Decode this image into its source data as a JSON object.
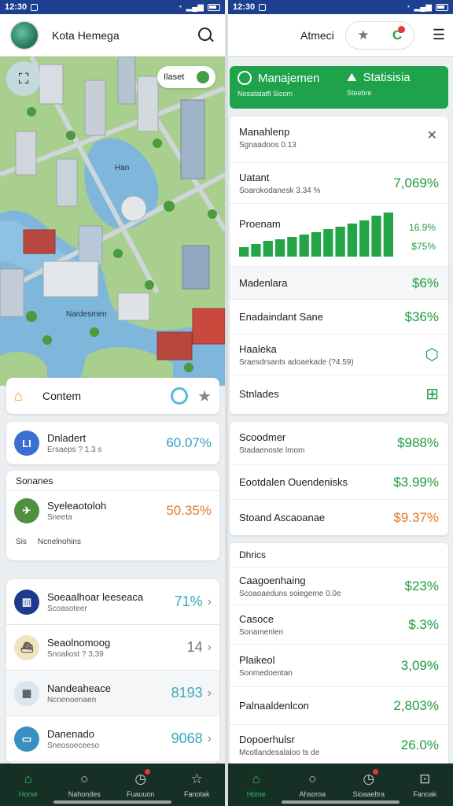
{
  "status_left": {
    "time": "12:30"
  },
  "status_right": {
    "time": "12:30"
  },
  "header_left": {
    "title": "Kota Hemega"
  },
  "header_right": {
    "user_name": "Atmeci"
  },
  "map": {
    "toggle_label": "Ilaset",
    "labels": [
      "Han",
      "Nardesmen"
    ]
  },
  "content_bar": {
    "label": "Contem"
  },
  "stat_card": {
    "icon_text": "LI",
    "title": "Dnladert",
    "subtitle": "Ersaeps ? 1.3 s",
    "value": "60.07%"
  },
  "sources": {
    "header": "Sonanes",
    "row": {
      "title": "Syeleaotoloh",
      "subtitle": "Sneeta",
      "value": "50.35%"
    },
    "footer": {
      "tag": "Sis",
      "text": "Ncnelnohins"
    }
  },
  "list": [
    {
      "title": "Soeaalhoar leeseaca",
      "subtitle": "Scoasoteer",
      "value": "71%",
      "color": "#1f3a8a"
    },
    {
      "title": "Seaolnomoog",
      "subtitle": "Snoaliost ? 3,39",
      "value": "14",
      "color": "#f0e3c0"
    },
    {
      "title": "Nandeaheace",
      "subtitle": "Ncnenoenaen",
      "value": "8193",
      "color": "#d9e6ef"
    },
    {
      "title": "Danenado",
      "subtitle": "Sneosoeceeso",
      "value": "9068",
      "color": "#3a8fc2"
    }
  ],
  "tabs": [
    {
      "label": "Manajemen",
      "sub": "Nosatalatfl Sicom"
    },
    {
      "label": "Statisisia",
      "sub": "Steebre"
    }
  ],
  "panel1": {
    "title": "Manahlenp",
    "subtitle": "Sgnaadoos 0.13",
    "rows": [
      {
        "title": "Uatant",
        "subtitle": "Soarokodanesk 3.34 %",
        "value": "7,069%"
      },
      {
        "title": "Madenlara",
        "value": "$6%"
      },
      {
        "title": "Enadaindant Sane",
        "value": "$36%"
      },
      {
        "title": "Haaleka",
        "subtitle": "Sraesdrsants adoaekade (?4.59)"
      },
      {
        "title": "Stnlades"
      }
    ],
    "chart": {
      "title": "Proenam",
      "label_top": "16.9%",
      "label_bottom": "$75%"
    }
  },
  "chart_data": {
    "type": "bar",
    "values": [
      12,
      16,
      20,
      22,
      25,
      28,
      31,
      35,
      38,
      42,
      46,
      52,
      56
    ],
    "color": "#22a447"
  },
  "panel2": {
    "rows": [
      {
        "title": "Scoodmer",
        "subtitle": "Stadaenoste lmom",
        "value": "$988%",
        "color": "#1e9c3f"
      },
      {
        "title": "Eootdalen Ouendenisks",
        "value": "$3.99%",
        "color": "#1e9c3f"
      },
      {
        "title": "Stoand Ascaoanae",
        "value": "$9.37%",
        "color": "#e07a2e"
      }
    ]
  },
  "panel3": {
    "header": "Dhrics",
    "rows": [
      {
        "title": "Caagoenhaing",
        "subtitle": "Scoaoaeduns soiegeme 0.0e",
        "value": "$23%"
      },
      {
        "title": "Casoce",
        "subtitle": "Sonamenlen",
        "value": "$.3%"
      },
      {
        "title": "Plaikeol",
        "subtitle": "Sonmedoentan",
        "value": "3,09%"
      },
      {
        "title": "Palnaaldenlcon",
        "value": "2,803%"
      },
      {
        "title": "Dopoerhulsr",
        "subtitle": "Mcotlandesalaloo ts de",
        "value": "26.0%"
      }
    ]
  },
  "nav_left": [
    {
      "label": "Horse",
      "icon": "home-icon"
    },
    {
      "label": "Nahondes",
      "icon": "search-icon"
    },
    {
      "label": "Fuauuon",
      "icon": "history-icon"
    },
    {
      "label": "Fanotak",
      "icon": "star-icon"
    }
  ],
  "nav_right": [
    {
      "label": "Home",
      "icon": "home-icon"
    },
    {
      "label": "Ahsoroa",
      "icon": "search-icon"
    },
    {
      "label": "Sioaaeltra",
      "icon": "history-icon"
    },
    {
      "label": "Fanoak",
      "icon": "inbox-icon"
    }
  ]
}
